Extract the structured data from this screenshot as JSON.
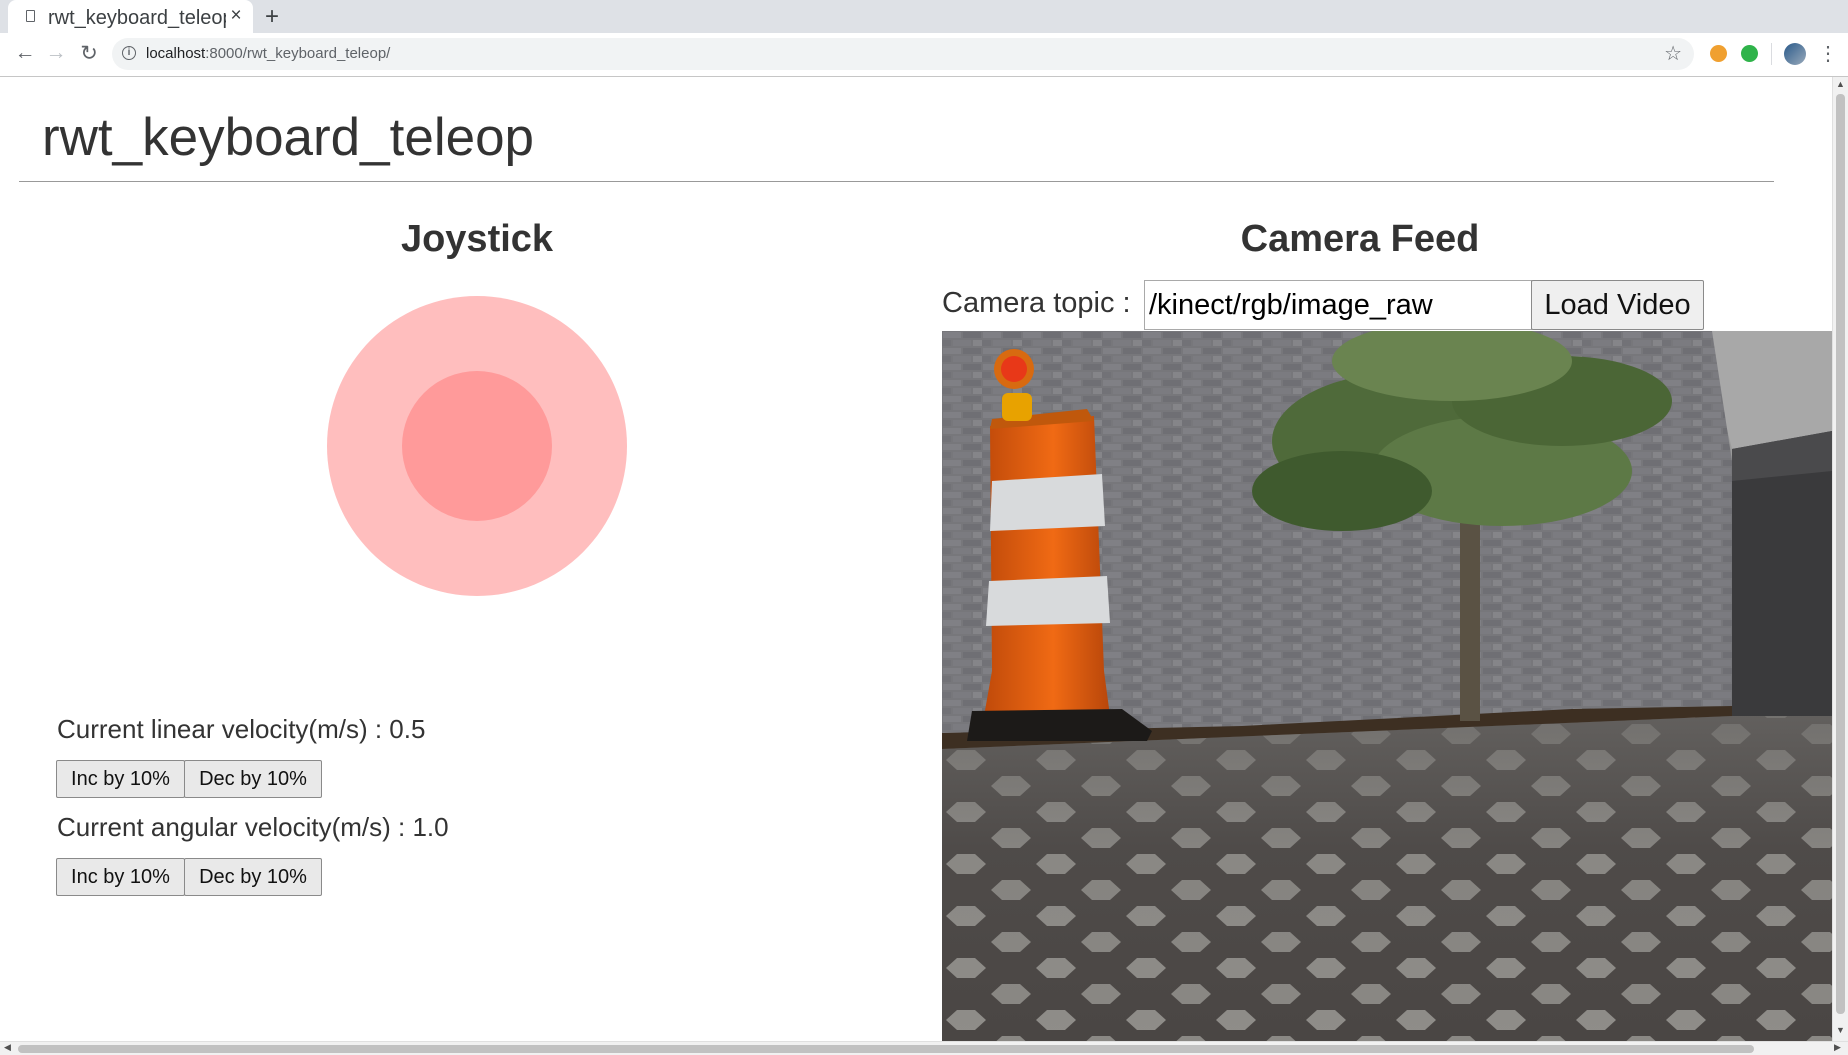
{
  "browser": {
    "tab_title": "rwt_keyboard_teleop",
    "tab_close": "×",
    "new_tab": "+",
    "url_host": "localhost",
    "url_rest": ":8000/rwt_keyboard_teleop/",
    "icons": [
      "doc-icon",
      "back-icon",
      "forward-icon",
      "reload-icon",
      "info-icon",
      "star-icon",
      "extension-icon",
      "grammarly-icon",
      "profile-avatar",
      "menu-icon"
    ]
  },
  "page": {
    "title": "rwt_keyboard_teleop",
    "joystick_heading": "Joystick",
    "linear_label": "Current linear velocity(m/s) : 0.5",
    "angular_label": "Current angular velocity(m/s) : 1.0",
    "inc_label": "Inc by 10%",
    "dec_label": "Dec by 10%",
    "camera_heading": "Camera Feed",
    "camera_topic_label": "Camera topic :",
    "camera_topic_value": "/kinect/rgb/image_raw",
    "load_video_label": "Load Video"
  },
  "colors": {
    "joystick_outer": "#ffbebe",
    "joystick_inner": "#ff9a9a"
  }
}
